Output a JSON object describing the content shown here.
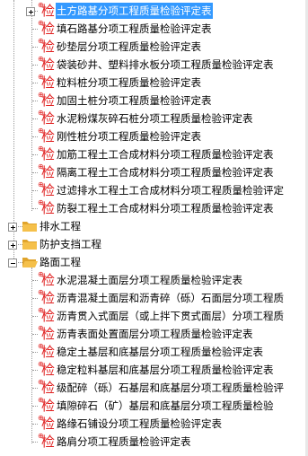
{
  "tree": {
    "group1_items": [
      {
        "label": "土方路基分项工程质量检验评定表",
        "selected": true
      },
      {
        "label": "填石路基分项工程质量检验评定表"
      },
      {
        "label": "砂垫层分项工程质量检验评定表"
      },
      {
        "label": "袋装砂井、塑料排水板分项工程质量检验评定表"
      },
      {
        "label": "粒料桩分项工程质量检验评定表"
      },
      {
        "label": "加固土桩分项工程质量检验评定表"
      },
      {
        "label": "水泥粉煤灰碎石桩分项工程质量检验评定表"
      },
      {
        "label": "刚性桩分项工程质量检验评定表"
      },
      {
        "label": "加筋工程土工合成材料分项工程质量检验评定表"
      },
      {
        "label": "隔离工程土工合成材料分项工程质量检验评定表"
      },
      {
        "label": "过滤排水工程土工合成材料分项工程质量检验评定"
      },
      {
        "label": "防裂工程土工合成材料分项工程质量检验评定表"
      }
    ],
    "folders": [
      {
        "label": "排水工程",
        "expanded": false
      },
      {
        "label": "防护支挡工程",
        "expanded": false
      },
      {
        "label": "路面工程",
        "expanded": true
      }
    ],
    "group2_items": [
      {
        "label": "水泥混凝土面层分项工程质量检验评定表"
      },
      {
        "label": "沥青混凝土面层和沥青碎（砾）石面层分项工程质"
      },
      {
        "label": "沥青贯入式面层（或上拌下贯式面层）分项工程质"
      },
      {
        "label": "沥青表面处置面层分项工程质量检验评定表"
      },
      {
        "label": "稳定土基层和底基层分项工程质量检验评定表"
      },
      {
        "label": "稳定粒料基层和底基层分项工程质量检验评定表"
      },
      {
        "label": "级配碎（砾）石基层和底基层分项工程质量检验评"
      },
      {
        "label": "填隙碎石（矿）基层和底基层分项工程质量检验"
      },
      {
        "label": "路缘石铺设分项工程质量检验评定表"
      },
      {
        "label": "路肩分项工程质量检验评定表"
      }
    ],
    "doc_icon_glyph": "检",
    "doc_icon_mark": "⊕",
    "colors": {
      "selection": "#3399ff",
      "doc_icon": "#e02020",
      "folder": "#f5c04a"
    }
  }
}
